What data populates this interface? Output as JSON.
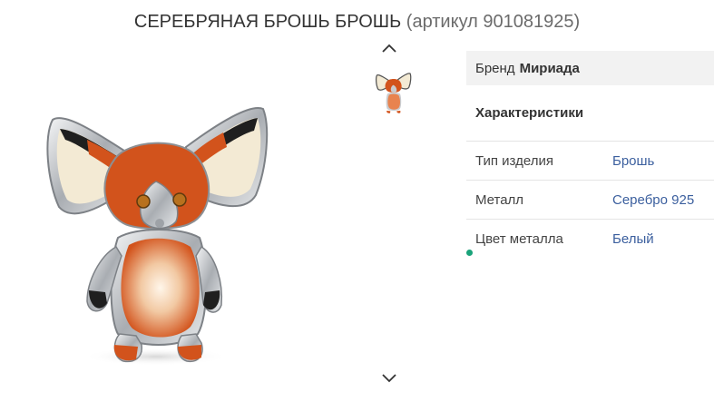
{
  "product": {
    "title": "СЕРЕБРЯНАЯ БРОШЬ БРОШЬ",
    "sku_text": "(артикул 901081925)"
  },
  "gallery": {
    "main_image_icon": "fox-brooch-image",
    "thumb_icon": "fox-brooch-thumbnail",
    "prev_icon": "chevron-up-icon",
    "next_icon": "chevron-down-icon"
  },
  "brand": {
    "label": "Бренд",
    "value": "Мириада"
  },
  "characteristics": {
    "heading": "Характеристики",
    "rows": [
      {
        "label": "Тип изделия",
        "value": "Брошь"
      },
      {
        "label": "Металл",
        "value": "Серебро 925"
      },
      {
        "label": "Цвет металла",
        "value": "Белый"
      }
    ]
  },
  "colors": {
    "link": "#3b5f9e",
    "accent_dot": "#1aa37a",
    "enamel_orange": "#d2531c",
    "enamel_cream": "#f3ead4",
    "silver": "#c9ccd0"
  }
}
